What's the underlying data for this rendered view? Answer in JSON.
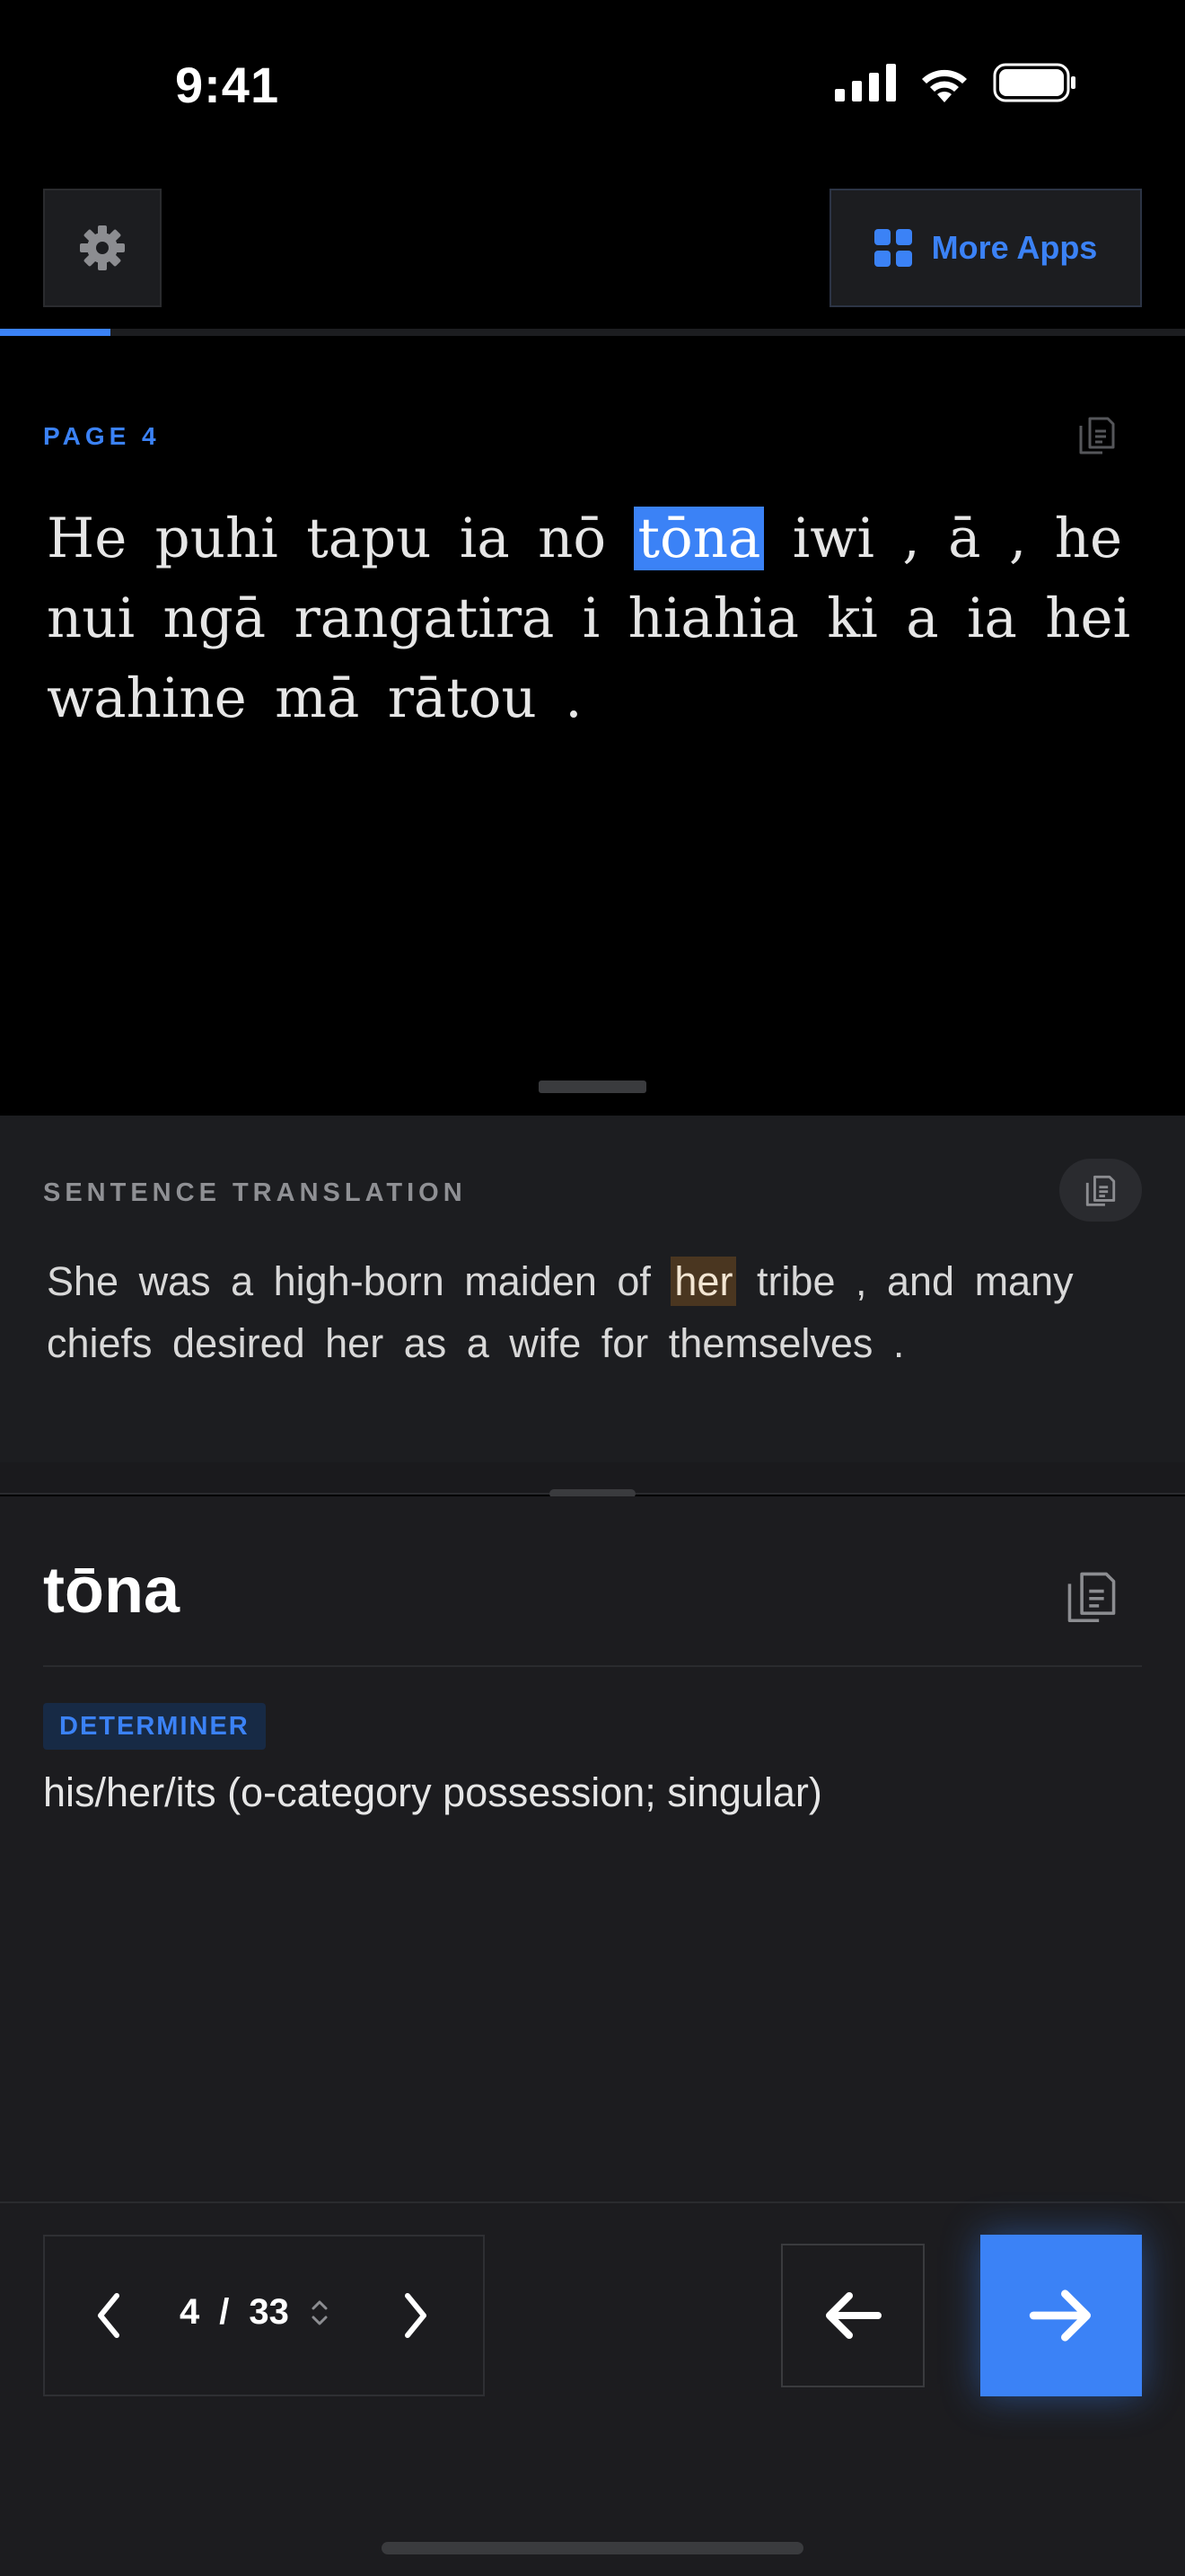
{
  "status_bar": {
    "time": "9:41"
  },
  "header": {
    "more_apps_label": "More Apps",
    "progress_fraction": 0.093
  },
  "reader": {
    "page_label": "PAGE  4",
    "sentence_before": "He puhi tapu ia nō ",
    "highlighted_word": "tōna",
    "sentence_after": " iwi , ā , he nui ngā rangatira i hiahia ki a ia hei wahine mā rātou ."
  },
  "translation": {
    "heading": "SENTENCE TRANSLATION",
    "text_before": "She was a high-born maiden of ",
    "highlighted_word": "her",
    "text_after": " tribe , and many  chiefs desired her as a wife for themselves ."
  },
  "dictionary": {
    "word": "tōna",
    "part_of_speech": "DETERMINER",
    "definition": "his/her/its (o-category possession; singular)"
  },
  "pager": {
    "current": "4",
    "separator": "/",
    "total": "33"
  },
  "colors": {
    "accent": "#3b82f6",
    "background": "#000000",
    "panel": "#1c1d20",
    "translation_highlight": "#4a3620"
  },
  "icons": [
    "signal-icon",
    "wifi-icon",
    "battery-icon",
    "gear-icon",
    "grid-icon",
    "copy-icon",
    "chevron-left-icon",
    "chevron-right-icon",
    "updown-icon",
    "arrow-left-icon",
    "arrow-right-icon"
  ]
}
